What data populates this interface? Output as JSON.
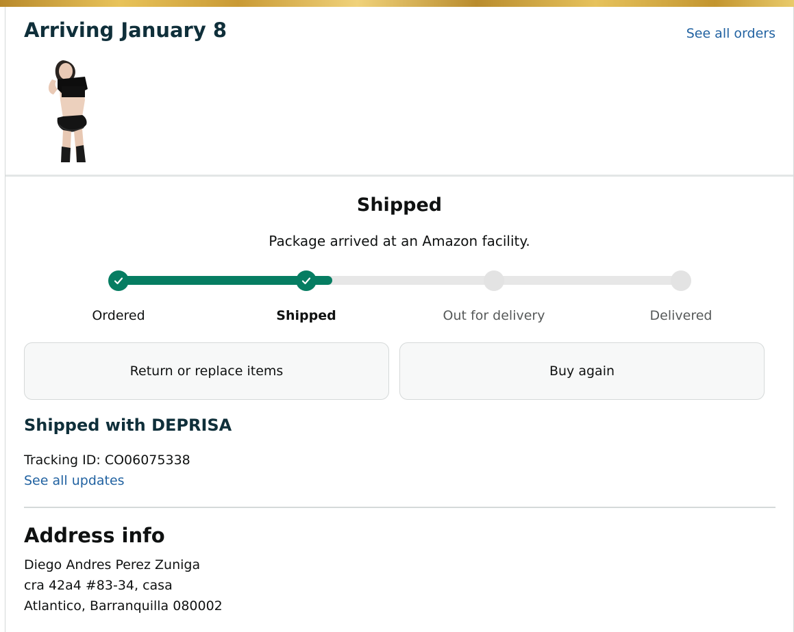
{
  "header": {
    "title": "Arriving January 8",
    "see_all_orders": "See all orders"
  },
  "status": {
    "title": "Shipped",
    "message": "Package arrived at an Amazon facility.",
    "progress": 0.38,
    "colors": {
      "done": "#067d62",
      "pending": "#e3e3e3"
    },
    "steps": [
      {
        "label": "Ordered",
        "state": "done"
      },
      {
        "label": "Shipped",
        "state": "current"
      },
      {
        "label": "Out for delivery",
        "state": "pending"
      },
      {
        "label": "Delivered",
        "state": "pending"
      }
    ]
  },
  "actions": {
    "return_label": "Return or replace items",
    "buy_again_label": "Buy again"
  },
  "shipping": {
    "carrier_heading": "Shipped with DEPRISA",
    "tracking_text": "Tracking ID: CO06075338",
    "see_updates": "See all updates"
  },
  "address": {
    "title": "Address info",
    "lines": [
      "Diego Andres Perez Zuniga",
      "cra 42a4 #83-34, casa",
      "Atlantico, Barranquilla 080002"
    ]
  }
}
